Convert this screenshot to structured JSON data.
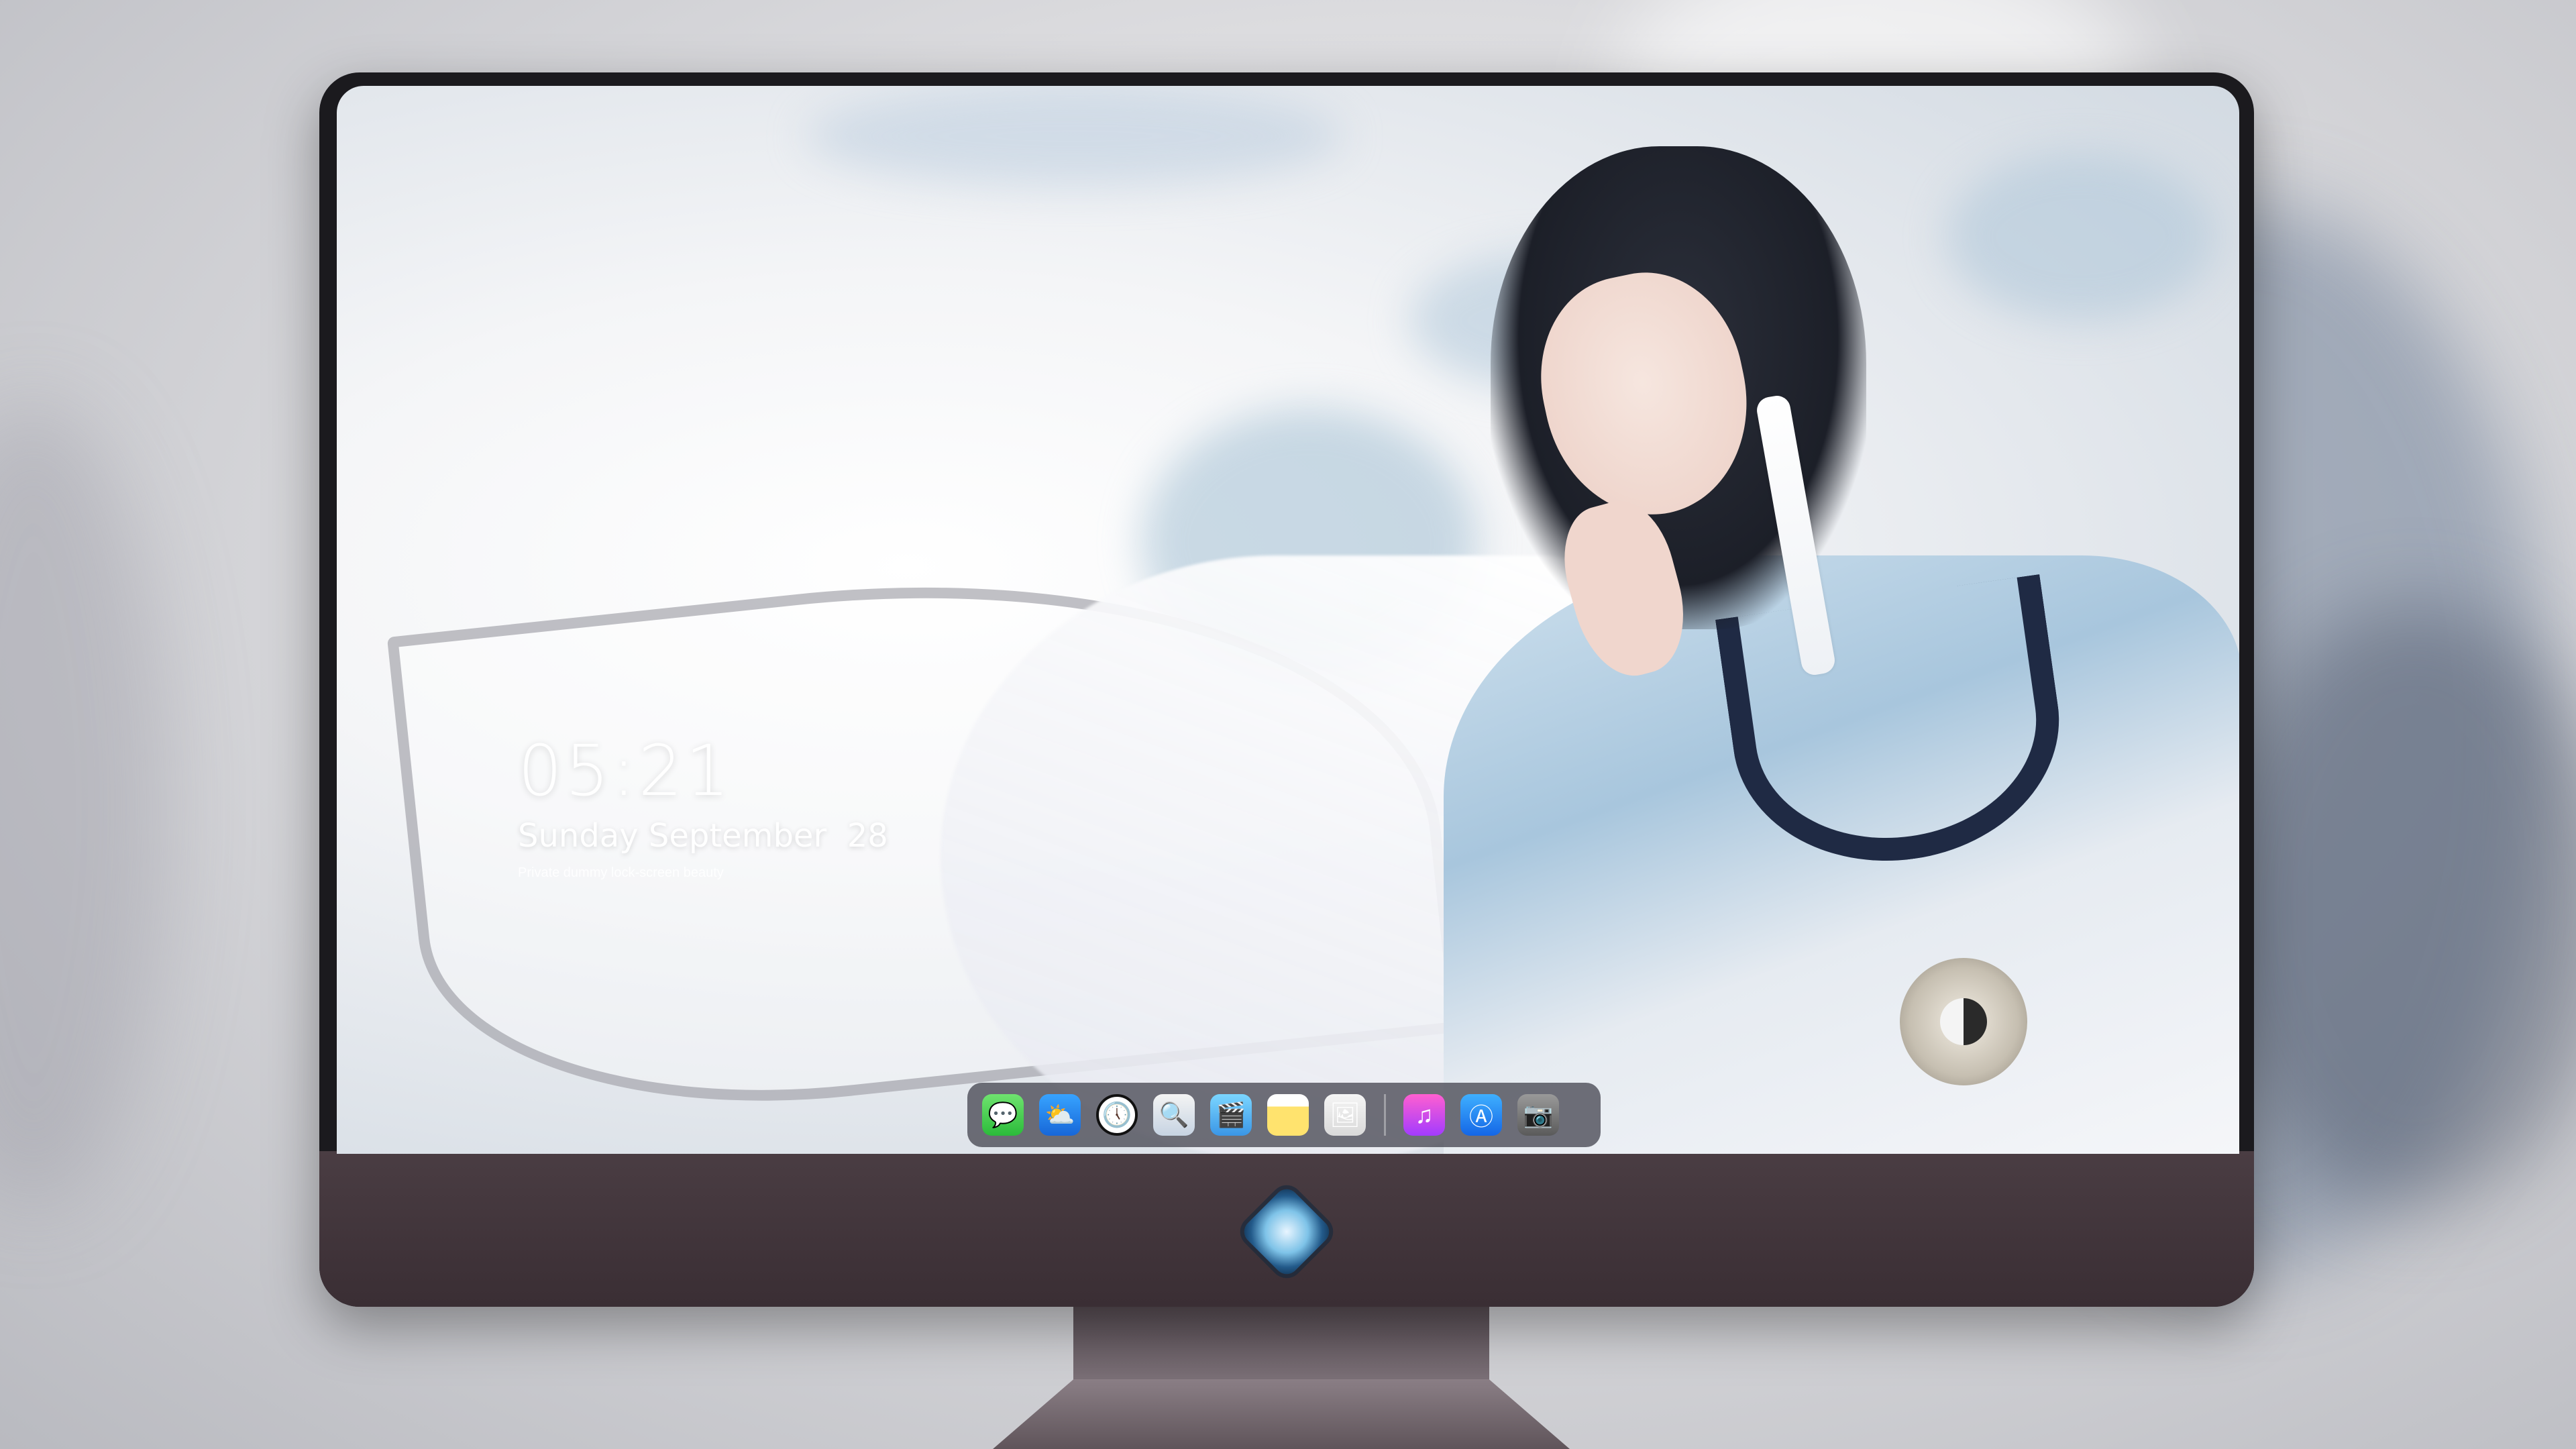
{
  "lockscreen": {
    "time": "05:21",
    "date": "Sunday September  28",
    "caption": "Private dummy lock-screen beauty"
  },
  "dock": {
    "apps": [
      {
        "id": "messages",
        "icon": "messages-icon",
        "glyph": "💬"
      },
      {
        "id": "weather",
        "icon": "weather-icon",
        "glyph": "⛅"
      },
      {
        "id": "clock",
        "icon": "clock-icon",
        "glyph": "🕔"
      },
      {
        "id": "preview",
        "icon": "preview-icon",
        "glyph": "🔍"
      },
      {
        "id": "video",
        "icon": "video-icon",
        "glyph": "🎬"
      },
      {
        "id": "notes",
        "icon": "notes-icon",
        "glyph": ""
      },
      {
        "id": "photos",
        "icon": "photos-icon",
        "glyph": "🖼"
      },
      {
        "id": "music",
        "icon": "music-icon",
        "glyph": "♫"
      },
      {
        "id": "appstore",
        "icon": "app-store-icon",
        "glyph": "Ⓐ"
      },
      {
        "id": "camera",
        "icon": "camera-icon",
        "glyph": "📷"
      }
    ]
  },
  "colors": {
    "monitor_bezel": "#1b1a1e",
    "monitor_chin": "#4a3d43",
    "dock_background": "#3c3c46"
  }
}
